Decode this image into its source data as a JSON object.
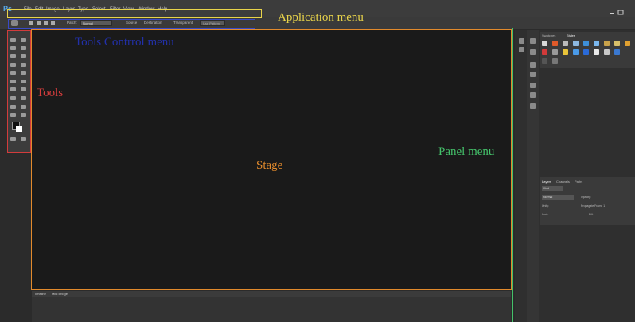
{
  "app": {
    "logo": "Ps"
  },
  "menu": [
    "File",
    "Edit",
    "Image",
    "Layer",
    "Type",
    "Select",
    "Filter",
    "View",
    "Window",
    "Help"
  ],
  "options": {
    "patch_label": "Patch:",
    "patch_value": "Normal",
    "source": "Source",
    "destination": "Destination",
    "transparent": "Transparent",
    "use_pattern": "Use Pattern"
  },
  "workspace": "Essentials",
  "timeline_tabs": [
    "Timeline",
    "Mini Bridge"
  ],
  "right_tabs": {
    "swatches": "Swatches",
    "styles": "Styles"
  },
  "layers_tabs": [
    "Layers",
    "Channels",
    "Paths"
  ],
  "layers": {
    "kind": "Kind",
    "mode": "Normal",
    "opacity_label": "Opacity:",
    "unify_label": "Unify:",
    "propagate": "Propagate Frame 1",
    "lock_label": "Lock:",
    "fill_label": "Fill:"
  },
  "annotations": {
    "application_menu": "Application menu",
    "tools_control_menu": "Tools Contrrol menu",
    "tools": "Tools",
    "stage": "Stage",
    "panel_menu": "Panel menu"
  },
  "colors": {
    "app_menu": "#e8d34a",
    "tools_control": "#2230a8",
    "tools": "#d23c3c",
    "stage": "#e28a2c",
    "panel": "#44c16a"
  }
}
